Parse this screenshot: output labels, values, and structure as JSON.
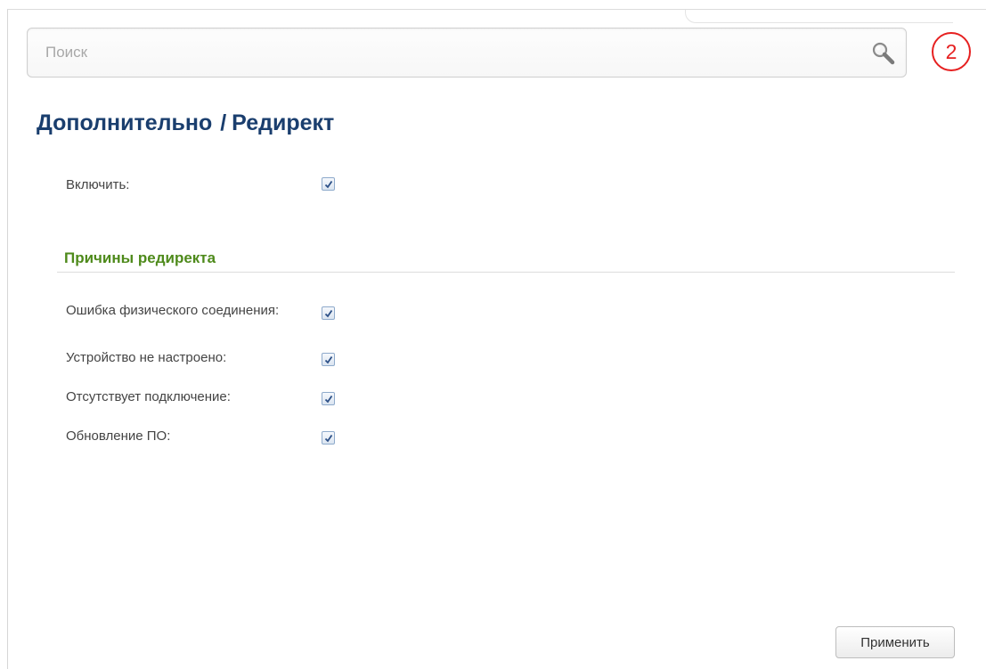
{
  "search": {
    "placeholder": "Поиск"
  },
  "badge": {
    "text": "2",
    "color": "#e62020"
  },
  "breadcrumb": {
    "parent": "Дополнительно",
    "separator": "/",
    "current": "Редирект"
  },
  "enable": {
    "label": "Включить:",
    "checked": true
  },
  "reasons": {
    "title": "Причины редиректа",
    "items": [
      {
        "label": "Ошибка физического соединения:",
        "checked": true
      },
      {
        "label": "Устройство не настроено:",
        "checked": true
      },
      {
        "label": "Отсутствует подключение:",
        "checked": true
      },
      {
        "label": "Обновление ПО:",
        "checked": true
      }
    ]
  },
  "actions": {
    "apply_label": "Применить"
  },
  "colors": {
    "title": "#1a3e6e",
    "section_title": "#4e8a1b",
    "accent_badge": "#e62020"
  },
  "icons": {
    "search": "magnifier-icon",
    "checkmark": "checkmark-icon"
  }
}
